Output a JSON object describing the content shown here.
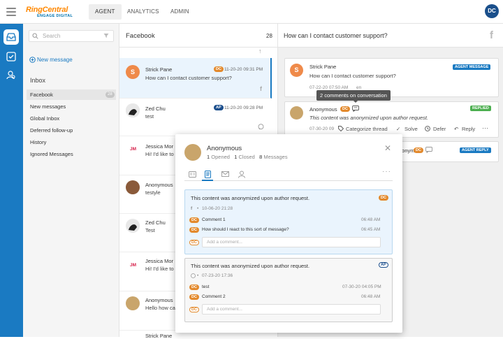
{
  "topbar": {
    "brand": "RingCentral",
    "brand_sub": "ENGAGE DIGITAL",
    "tabs": [
      "AGENT",
      "ANALYTICS",
      "ADMIN"
    ],
    "user_initials": "DC"
  },
  "sidebar": {
    "search_placeholder": "Search",
    "new_message": "New message",
    "inbox_title": "Inbox",
    "items": [
      {
        "label": "Facebook",
        "count": "28"
      },
      {
        "label": "New messages"
      },
      {
        "label": "Global Inbox"
      },
      {
        "label": "Deferred follow-up"
      },
      {
        "label": "History"
      },
      {
        "label": "Ignored Messages"
      }
    ]
  },
  "list": {
    "title": "Facebook",
    "count": "28",
    "rows": [
      {
        "name": "Strick Pane",
        "badge": "DC",
        "time": "11-20-20 09:31 PM",
        "text": "How can I contact customer support?"
      },
      {
        "name": "Zed Chu",
        "badge": "AP",
        "time": "11-20-20 09:28 PM",
        "text": "test"
      },
      {
        "name": "Jessica Mor",
        "initials": "JM",
        "text": "Hi! I'd like to"
      },
      {
        "name": "Anonymous",
        "text": "testyle"
      },
      {
        "name": "Zed Chu",
        "text": "Test"
      },
      {
        "name": "Jessica Mor",
        "initials": "JM",
        "text": "Hi! I'd like to"
      },
      {
        "name": "Anonymous",
        "text": "Hello how ca"
      },
      {
        "name": "Strick Pane",
        "text": ""
      }
    ]
  },
  "thread": {
    "title": "How can I contact customer support?",
    "messages": [
      {
        "author": "Strick Pane",
        "text": "How can I contact customer support?",
        "meta": "07-22-20 07:50 AM",
        "lang": "en",
        "tag": "AGENT MESSAGE"
      },
      {
        "author": "Anonymous",
        "badge": "DC",
        "text": "This content was anonymized upon author request.",
        "meta": "07-30-20 09",
        "tag": "REPLIED",
        "actions": [
          "Categorize thread",
          "Solve",
          "Defer",
          "Reply"
        ]
      },
      {
        "author": "Anonymous",
        "badge": "DC",
        "tag": "AGENT REPLY"
      }
    ],
    "tooltip": "2 comments on conversation"
  },
  "modal": {
    "name": "Anonymous",
    "opened": "1",
    "opened_label": "Opened",
    "closed": "1",
    "closed_label": "Closed",
    "messages": "8",
    "messages_label": "Messages",
    "notes": [
      {
        "text": "This content was anonymized upon author request.",
        "badge": "DC",
        "source": "f",
        "date": "10-06-20 21:28",
        "comments": [
          {
            "badge": "DC",
            "text": "Comment 1",
            "time": "06:48 AM"
          },
          {
            "badge": "DC",
            "text": "How should I react to this sort of message?",
            "time": "06:45 AM"
          }
        ],
        "add_placeholder": "Add a comment..."
      },
      {
        "text": "This content was anonymized upon author request.",
        "badge": "AP",
        "date": "07-23-20 17:36",
        "comments": [
          {
            "badge": "DC",
            "text": "test",
            "time": "07-30-20 04:05 PM"
          },
          {
            "badge": "DC",
            "text": "Comment 2",
            "time": "06:48 AM"
          }
        ],
        "add_placeholder": "Add a comment..."
      }
    ]
  }
}
